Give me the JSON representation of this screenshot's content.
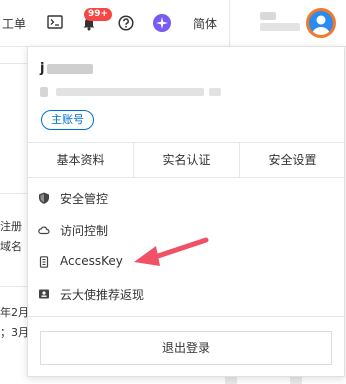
{
  "topbar": {
    "workorder_label": "工单",
    "message_badge": "99+",
    "language_label": "简体"
  },
  "background_text": {
    "line1": "注册",
    "line2": "域名",
    "line3": "年2月",
    "line4": "；3月"
  },
  "account": {
    "name_initial": "j",
    "tag": "主账号"
  },
  "tabs": [
    "基本资料",
    "实名认证",
    "安全设置"
  ],
  "menu": [
    {
      "label": "安全管控",
      "icon": "shield-icon"
    },
    {
      "label": "访问控制",
      "icon": "cloud-icon"
    },
    {
      "label": "AccessKey",
      "icon": "key-icon"
    },
    {
      "label": "云大使推荐返现",
      "icon": "id-card-icon"
    }
  ],
  "logout_label": "退出登录",
  "colors": {
    "accent": "#0070cc",
    "badge": "#f54743",
    "annotation_arrow": "#f05166"
  }
}
